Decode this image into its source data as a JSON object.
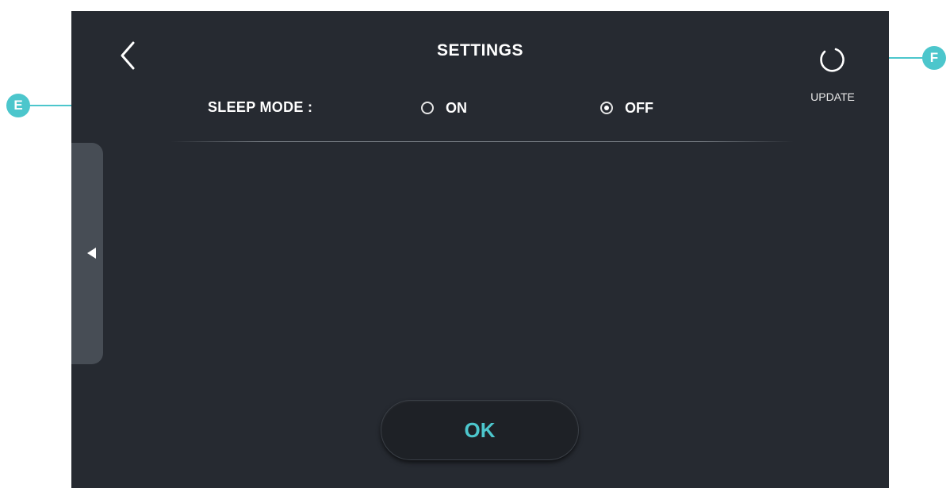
{
  "header": {
    "title": "SETTINGS",
    "back_icon": "chevron-left-icon",
    "update_label": "UPDATE",
    "update_icon": "refresh-icon"
  },
  "settings": {
    "sleep_mode_label": "SLEEP MODE :",
    "options": [
      {
        "label": "ON",
        "selected": false
      },
      {
        "label": "OFF",
        "selected": true
      }
    ]
  },
  "footer": {
    "ok_label": "OK"
  },
  "callouts": {
    "e": "E",
    "f": "F"
  },
  "colors": {
    "background": "#262a31",
    "accent": "#4cc6cc",
    "side_tab": "#474d55"
  }
}
